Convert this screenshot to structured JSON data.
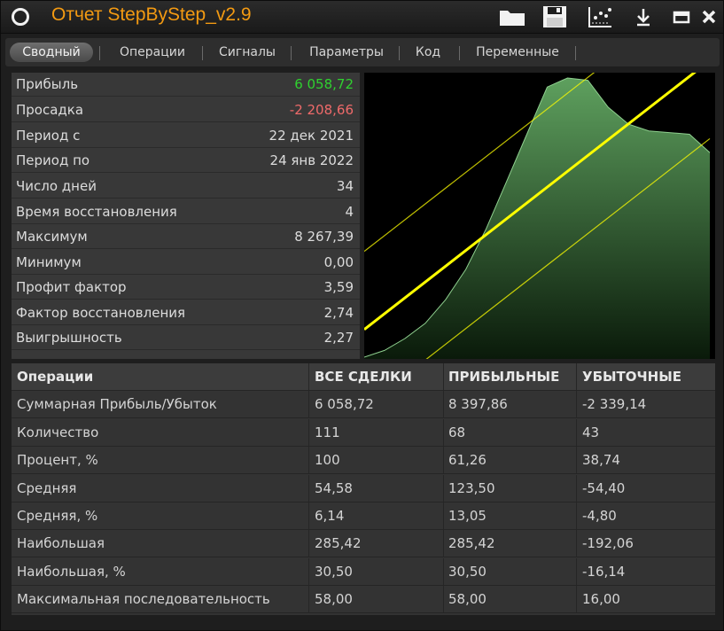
{
  "window": {
    "title": "Отчет StepByStep_v2.9",
    "toolbar_icons": [
      "circle-icon",
      "folder-icon",
      "save-icon",
      "chart-settings-icon",
      "download-icon",
      "minimize-icon",
      "close-icon"
    ]
  },
  "tabs": [
    {
      "label": "Сводный",
      "active": true
    },
    {
      "label": "Операции"
    },
    {
      "label": "Сигналы"
    },
    {
      "label": "Параметры"
    },
    {
      "label": "Код"
    },
    {
      "label": "Переменные"
    }
  ],
  "summary": [
    {
      "label": "Прибыль",
      "value": "6 058,72",
      "color": "#2fd12f"
    },
    {
      "label": "Просадка",
      "value": "-2 208,66",
      "color": "#ef6a6a"
    },
    {
      "label": "Период с",
      "value": "22 дек 2021"
    },
    {
      "label": "Период по",
      "value": "24 янв 2022"
    },
    {
      "label": "Число дней",
      "value": "34"
    },
    {
      "label": "Время восстановления",
      "value": "4"
    },
    {
      "label": "Максимум",
      "value": "8 267,39"
    },
    {
      "label": "Минимум",
      "value": "0,00"
    },
    {
      "label": "Профит фактор",
      "value": "3,59"
    },
    {
      "label": "Фактор восстановления",
      "value": "2,74"
    },
    {
      "label": "Выигрышность",
      "value": "2,27"
    }
  ],
  "chart_data": {
    "type": "area",
    "x": [
      0,
      2,
      4,
      6,
      8,
      10,
      12,
      14,
      16,
      18,
      20,
      22,
      24,
      26,
      28,
      30,
      32,
      34
    ],
    "values": [
      0,
      200,
      550,
      1000,
      1700,
      2600,
      3800,
      5200,
      6600,
      8000,
      8267,
      8200,
      7400,
      6900,
      6700,
      6650,
      6600,
      6058
    ],
    "ylim": [
      0,
      8267.39
    ],
    "colors": {
      "area_top": "#5ea05e",
      "area_bottom": "#0a1a0a",
      "line": "#ffff00"
    }
  },
  "operations": {
    "headers": [
      "Операции",
      "ВСЕ СДЕЛКИ",
      "ПРИБЫЛЬНЫЕ",
      "УБЫТОЧНЫЕ"
    ],
    "rows": [
      [
        "Суммарная Прибыль/Убыток",
        "6 058,72",
        "8 397,86",
        "-2 339,14"
      ],
      [
        "Количество",
        "111",
        "68",
        "43"
      ],
      [
        "Процент, %",
        "100",
        "61,26",
        "38,74"
      ],
      [
        "Средняя",
        "54,58",
        "123,50",
        "-54,40"
      ],
      [
        "Средняя, %",
        "6,14",
        "13,05",
        "-4,80"
      ],
      [
        "Наибольшая",
        "285,42",
        "285,42",
        "-192,06"
      ],
      [
        "Наибольшая, %",
        "30,50",
        "30,50",
        "-16,14"
      ],
      [
        "Максимальная последовательность",
        "58,00",
        "58,00",
        "16,00"
      ]
    ]
  }
}
